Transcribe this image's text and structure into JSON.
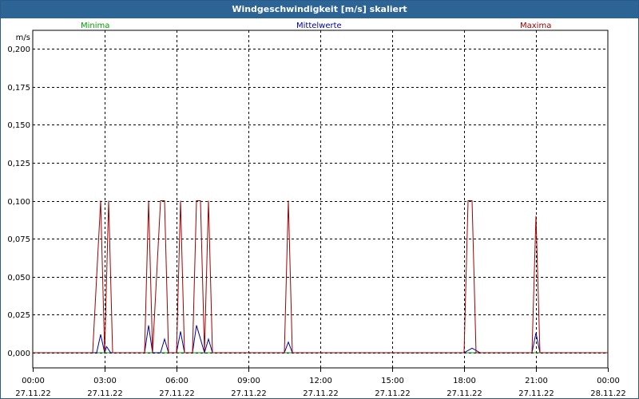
{
  "window": {
    "title": "Windgeschwindigkeit [m/s] skaliert"
  },
  "chart_data": {
    "type": "line",
    "title": "Windgeschwindigkeit [m/s] skaliert",
    "ylabel": "m/s",
    "ylim": [
      0,
      0.2
    ],
    "xlim": [
      "2022-11-27T00:00",
      "2022-11-28T00:00"
    ],
    "grid": true,
    "y_ticks": [
      "0,000",
      "0,025",
      "0,050",
      "0,075",
      "0,100",
      "0,125",
      "0,150",
      "0,175",
      "0,200"
    ],
    "x_ticks": [
      {
        "time": "00:00",
        "date": "27.11.22"
      },
      {
        "time": "03:00",
        "date": "27.11.22"
      },
      {
        "time": "06:00",
        "date": "27.11.22"
      },
      {
        "time": "09:00",
        "date": "27.11.22"
      },
      {
        "time": "12:00",
        "date": "27.11.22"
      },
      {
        "time": "15:00",
        "date": "27.11.22"
      },
      {
        "time": "18:00",
        "date": "27.11.22"
      },
      {
        "time": "21:00",
        "date": "27.11.22"
      },
      {
        "time": "00:00",
        "date": "28.11.22"
      }
    ],
    "legend": [
      "Minima",
      "Mittelwerte",
      "Maxima"
    ],
    "series": [
      {
        "name": "Minima",
        "color": "#00a000",
        "points": [
          [
            "00:00",
            0
          ],
          [
            "24:00",
            0
          ]
        ]
      },
      {
        "name": "Mittelwerte",
        "color": "#0000a0",
        "points": [
          [
            "02:40",
            0
          ],
          [
            "02:50",
            0.012
          ],
          [
            "03:00",
            0
          ],
          [
            "03:05",
            0.004
          ],
          [
            "03:15",
            0
          ],
          [
            "04:40",
            0
          ],
          [
            "04:50",
            0.018
          ],
          [
            "05:00",
            0
          ],
          [
            "05:20",
            0
          ],
          [
            "05:30",
            0.009
          ],
          [
            "05:40",
            0
          ],
          [
            "06:00",
            0
          ],
          [
            "06:10",
            0.014
          ],
          [
            "06:20",
            0
          ],
          [
            "06:40",
            0
          ],
          [
            "06:50",
            0.018
          ],
          [
            "07:10",
            0
          ],
          [
            "07:20",
            0.009
          ],
          [
            "07:30",
            0
          ],
          [
            "10:30",
            0
          ],
          [
            "10:40",
            0.007
          ],
          [
            "10:50",
            0
          ],
          [
            "18:00",
            0
          ],
          [
            "18:20",
            0.003
          ],
          [
            "18:40",
            0
          ],
          [
            "20:50",
            0
          ],
          [
            "21:00",
            0.013
          ],
          [
            "21:10",
            0
          ]
        ]
      },
      {
        "name": "Maxima",
        "color": "#a00000",
        "points": [
          [
            "02:30",
            0
          ],
          [
            "02:50",
            0.1
          ],
          [
            "03:00",
            0
          ],
          [
            "03:10",
            0.1
          ],
          [
            "03:20",
            0
          ],
          [
            "04:40",
            0
          ],
          [
            "04:50",
            0.1
          ],
          [
            "05:00",
            0
          ],
          [
            "05:20",
            0.1
          ],
          [
            "05:30",
            0.1
          ],
          [
            "05:40",
            0
          ],
          [
            "06:00",
            0
          ],
          [
            "06:10",
            0.1
          ],
          [
            "06:20",
            0
          ],
          [
            "06:40",
            0
          ],
          [
            "06:50",
            0.1
          ],
          [
            "07:00",
            0.1
          ],
          [
            "07:10",
            0
          ],
          [
            "07:20",
            0.1
          ],
          [
            "07:30",
            0
          ],
          [
            "10:30",
            0
          ],
          [
            "10:40",
            0.1
          ],
          [
            "10:50",
            0
          ],
          [
            "18:00",
            0
          ],
          [
            "18:10",
            0.1
          ],
          [
            "18:20",
            0.1
          ],
          [
            "18:30",
            0
          ],
          [
            "20:50",
            0
          ],
          [
            "21:00",
            0.09
          ],
          [
            "21:10",
            0
          ]
        ]
      }
    ]
  }
}
